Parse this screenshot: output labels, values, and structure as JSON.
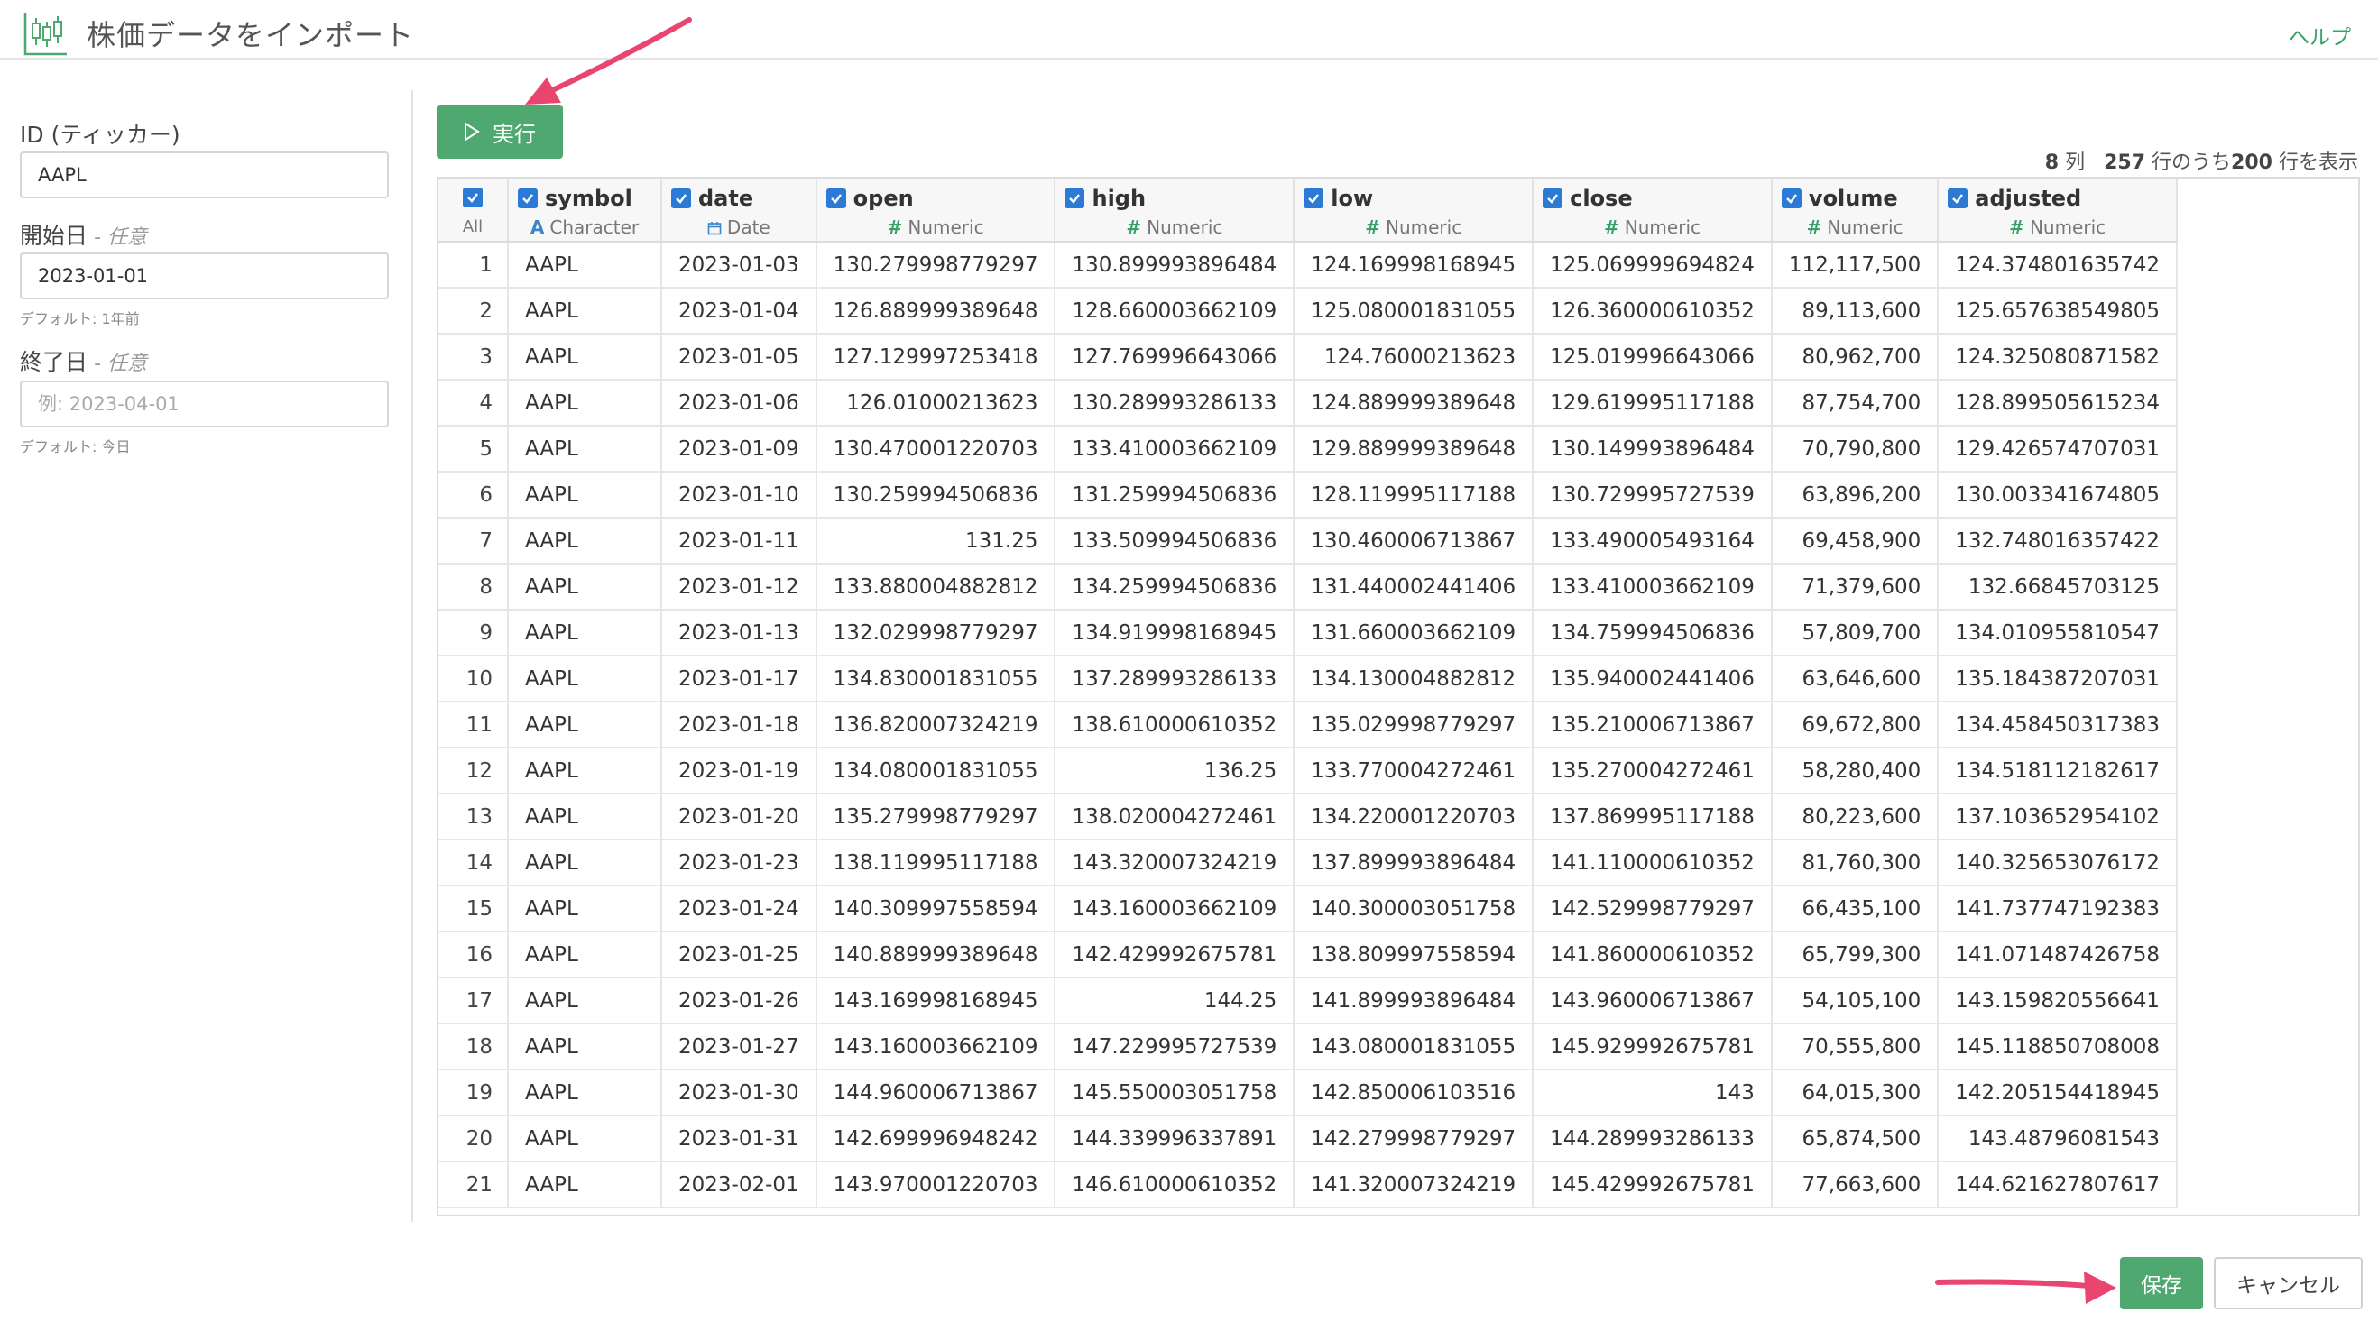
{
  "header": {
    "title": "株価データをインポート",
    "help": "ヘルプ"
  },
  "sidebar": {
    "ticker": {
      "label": "ID (ティッカー)",
      "value": "AAPL"
    },
    "start": {
      "label": "開始日",
      "optional": " - 任意",
      "value": "2023-01-01",
      "hint": "デフォルト: 1年前"
    },
    "end": {
      "label": "終了日",
      "optional": " - 任意",
      "placeholder": "例: 2023-04-01",
      "hint": "デフォルト: 今日"
    }
  },
  "toolbar": {
    "run_label": "実行"
  },
  "info": {
    "cols": "8",
    "cols_unit": "列",
    "total": "257",
    "mid": "行のうち",
    "shown": "200",
    "tail": "行を表示"
  },
  "table": {
    "all_label": "All",
    "columns": [
      {
        "name": "symbol",
        "type": "Character",
        "type_icon": "A"
      },
      {
        "name": "date",
        "type": "Date",
        "type_icon": "calendar-icon"
      },
      {
        "name": "open",
        "type": "Numeric",
        "type_icon": "#"
      },
      {
        "name": "high",
        "type": "Numeric",
        "type_icon": "#"
      },
      {
        "name": "low",
        "type": "Numeric",
        "type_icon": "#"
      },
      {
        "name": "close",
        "type": "Numeric",
        "type_icon": "#"
      },
      {
        "name": "volume",
        "type": "Numeric",
        "type_icon": "#"
      },
      {
        "name": "adjusted",
        "type": "Numeric",
        "type_icon": "#"
      }
    ],
    "rows": [
      [
        "1",
        "AAPL",
        "2023-01-03",
        "130.279998779297",
        "130.899993896484",
        "124.169998168945",
        "125.069999694824",
        "112,117,500",
        "124.374801635742"
      ],
      [
        "2",
        "AAPL",
        "2023-01-04",
        "126.889999389648",
        "128.660003662109",
        "125.080001831055",
        "126.360000610352",
        "89,113,600",
        "125.657638549805"
      ],
      [
        "3",
        "AAPL",
        "2023-01-05",
        "127.129997253418",
        "127.769996643066",
        "124.76000213623",
        "125.019996643066",
        "80,962,700",
        "124.325080871582"
      ],
      [
        "4",
        "AAPL",
        "2023-01-06",
        "126.01000213623",
        "130.289993286133",
        "124.889999389648",
        "129.619995117188",
        "87,754,700",
        "128.899505615234"
      ],
      [
        "5",
        "AAPL",
        "2023-01-09",
        "130.470001220703",
        "133.410003662109",
        "129.889999389648",
        "130.149993896484",
        "70,790,800",
        "129.426574707031"
      ],
      [
        "6",
        "AAPL",
        "2023-01-10",
        "130.259994506836",
        "131.259994506836",
        "128.119995117188",
        "130.729995727539",
        "63,896,200",
        "130.003341674805"
      ],
      [
        "7",
        "AAPL",
        "2023-01-11",
        "131.25",
        "133.509994506836",
        "130.460006713867",
        "133.490005493164",
        "69,458,900",
        "132.748016357422"
      ],
      [
        "8",
        "AAPL",
        "2023-01-12",
        "133.880004882812",
        "134.259994506836",
        "131.440002441406",
        "133.410003662109",
        "71,379,600",
        "132.66845703125"
      ],
      [
        "9",
        "AAPL",
        "2023-01-13",
        "132.029998779297",
        "134.919998168945",
        "131.660003662109",
        "134.759994506836",
        "57,809,700",
        "134.010955810547"
      ],
      [
        "10",
        "AAPL",
        "2023-01-17",
        "134.830001831055",
        "137.289993286133",
        "134.130004882812",
        "135.940002441406",
        "63,646,600",
        "135.184387207031"
      ],
      [
        "11",
        "AAPL",
        "2023-01-18",
        "136.820007324219",
        "138.610000610352",
        "135.029998779297",
        "135.210006713867",
        "69,672,800",
        "134.458450317383"
      ],
      [
        "12",
        "AAPL",
        "2023-01-19",
        "134.080001831055",
        "136.25",
        "133.770004272461",
        "135.270004272461",
        "58,280,400",
        "134.518112182617"
      ],
      [
        "13",
        "AAPL",
        "2023-01-20",
        "135.279998779297",
        "138.020004272461",
        "134.220001220703",
        "137.869995117188",
        "80,223,600",
        "137.103652954102"
      ],
      [
        "14",
        "AAPL",
        "2023-01-23",
        "138.119995117188",
        "143.320007324219",
        "137.899993896484",
        "141.110000610352",
        "81,760,300",
        "140.325653076172"
      ],
      [
        "15",
        "AAPL",
        "2023-01-24",
        "140.309997558594",
        "143.160003662109",
        "140.300003051758",
        "142.529998779297",
        "66,435,100",
        "141.737747192383"
      ],
      [
        "16",
        "AAPL",
        "2023-01-25",
        "140.889999389648",
        "142.429992675781",
        "138.809997558594",
        "141.860000610352",
        "65,799,300",
        "141.071487426758"
      ],
      [
        "17",
        "AAPL",
        "2023-01-26",
        "143.169998168945",
        "144.25",
        "141.899993896484",
        "143.960006713867",
        "54,105,100",
        "143.159820556641"
      ],
      [
        "18",
        "AAPL",
        "2023-01-27",
        "143.160003662109",
        "147.229995727539",
        "143.080001831055",
        "145.929992675781",
        "70,555,800",
        "145.118850708008"
      ],
      [
        "19",
        "AAPL",
        "2023-01-30",
        "144.960006713867",
        "145.550003051758",
        "142.850006103516",
        "143",
        "64,015,300",
        "142.205154418945"
      ],
      [
        "20",
        "AAPL",
        "2023-01-31",
        "142.699996948242",
        "144.339996337891",
        "142.279998779297",
        "144.289993286133",
        "65,874,500",
        "143.48796081543"
      ],
      [
        "21",
        "AAPL",
        "2023-02-01",
        "143.970001220703",
        "146.610000610352",
        "141.320007324219",
        "145.429992675781",
        "77,663,600",
        "144.621627807617"
      ]
    ]
  },
  "footer": {
    "save_label": "保存",
    "cancel_label": "キャンセル"
  },
  "colors": {
    "accent": "#4ea86f",
    "checkbox": "#2b7bd6",
    "annotation_arrow": "#e8466f"
  }
}
